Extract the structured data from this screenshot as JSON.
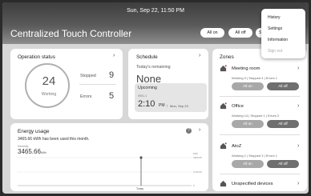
{
  "header": {
    "datetime": "Sun, Sep 22, 11:50 PM",
    "title": "Centralized Touch Controller",
    "buttons": {
      "all_on": "All on",
      "all_off": "All off",
      "truncated": "Se"
    }
  },
  "menu": {
    "items": [
      {
        "label": "History",
        "enabled": true
      },
      {
        "label": "Settings",
        "enabled": true
      },
      {
        "label": "Information",
        "enabled": true
      },
      {
        "label": "Sign out",
        "enabled": false
      }
    ]
  },
  "operation_status": {
    "title": "Operation status",
    "working_count": "24",
    "working_label": "Working",
    "stopped_label": "Stopped",
    "stopped_count": "9",
    "errors_label": "Errors",
    "errors_count": "5"
  },
  "schedule": {
    "title": "Schedule",
    "remaining_label": "Today's remaining",
    "remaining_value": "None",
    "upcoming_label": "Upcoming",
    "upcoming_code": "0901.1",
    "upcoming_time": "2:10",
    "upcoming_ampm": "PM",
    "upcoming_date": "Mon, Sep 23"
  },
  "energy": {
    "title": "Energy usage",
    "summary": "3465.66 kWh has been used this month.",
    "small_label": "Electricity",
    "value": "3465.66",
    "unit": "kWh",
    "y_labels": [
      "kWh",
      "3465.66",
      "1733.00",
      "0"
    ],
    "x_label": "Today"
  },
  "zones": {
    "title": "Zones",
    "items": [
      {
        "name": "Meeting room",
        "working_label": "Working",
        "working": "9",
        "stopped_label": "Stopped",
        "stopped": "4",
        "errors_label": "Errors",
        "errors": "1",
        "on_label": "All on",
        "off_label": "All off"
      },
      {
        "name": "Office",
        "working_label": "Working",
        "working": "14",
        "stopped_label": "Stopped",
        "stopped": "1",
        "errors_label": "Errors",
        "errors": "2",
        "on_label": "All on",
        "off_label": "All off"
      },
      {
        "name": "AtoZ",
        "working_label": "Working",
        "working": "1",
        "stopped_label": "Stopped",
        "stopped": "3",
        "errors_label": "Errors",
        "errors": "1",
        "on_label": "All on",
        "off_label": "All off"
      }
    ],
    "unspecified_label": "Unspecified devices"
  },
  "colors": {
    "header_dark": "#3e3e3e",
    "page_bg": "#d7d7d7",
    "button_dark": "#6f6f6f",
    "button_light": "#a8a8a8"
  }
}
